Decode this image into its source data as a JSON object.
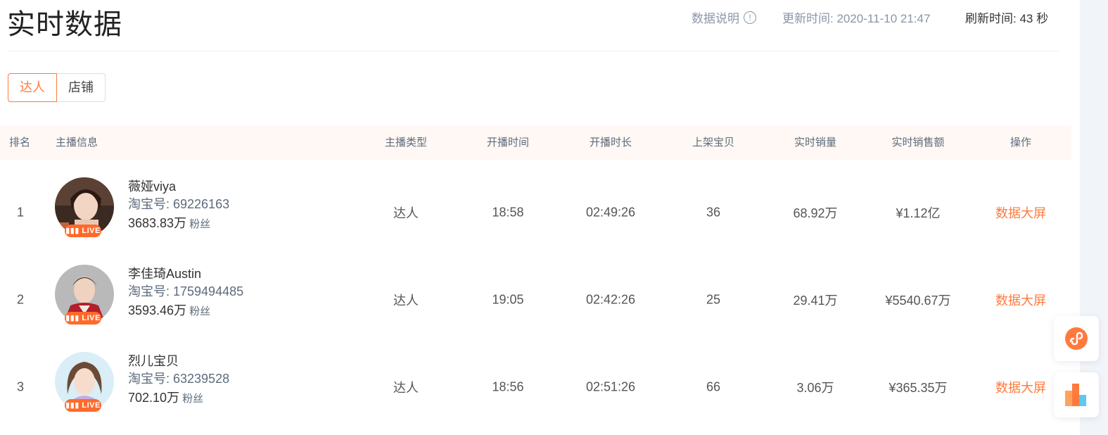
{
  "header": {
    "title": "实时数据",
    "help_label": "数据说明",
    "help_icon": "info-circle-icon",
    "updated_label": "更新时间: 2020-11-10 21:47",
    "refresh_label": "刷新时间:",
    "refresh_value": "43",
    "refresh_unit": "秒"
  },
  "tabs": [
    {
      "label": "达人",
      "active": true
    },
    {
      "label": "店铺",
      "active": false
    }
  ],
  "table": {
    "columns": [
      "排名",
      "主播信息",
      "主播类型",
      "开播时间",
      "开播时长",
      "上架宝贝",
      "实时销量",
      "实时销售额",
      "操作"
    ],
    "live_badge": "LIVE",
    "fans_label": "粉丝",
    "rows": [
      {
        "rank": "1",
        "name": "薇娅viya",
        "taobao_id": "淘宝号: 69226163",
        "fans": "3683.83万",
        "type": "达人",
        "start_time": "18:58",
        "duration": "02:49:26",
        "items": "36",
        "sales_volume": "68.92万",
        "sales_amount": "¥1.12亿",
        "action": "数据大屏"
      },
      {
        "rank": "2",
        "name": "李佳琦Austin",
        "taobao_id": "淘宝号: 1759494485",
        "fans": "3593.46万",
        "type": "达人",
        "start_time": "19:05",
        "duration": "02:42:26",
        "items": "25",
        "sales_volume": "29.41万",
        "sales_amount": "¥5540.67万",
        "action": "数据大屏"
      },
      {
        "rank": "3",
        "name": "烈儿宝贝",
        "taobao_id": "淘宝号: 63239528",
        "fans": "702.10万",
        "type": "达人",
        "start_time": "18:56",
        "duration": "02:51:26",
        "items": "66",
        "sales_volume": "3.06万",
        "sales_amount": "¥365.35万",
        "action": "数据大屏"
      }
    ]
  },
  "floating": {
    "mini_program_icon": "mini-program-icon",
    "chart_icon": "bar-chart-icon"
  },
  "colors": {
    "accent": "#ff7a3d",
    "header_bg": "#fff8f4",
    "live_badge": "#ff6a2b"
  }
}
